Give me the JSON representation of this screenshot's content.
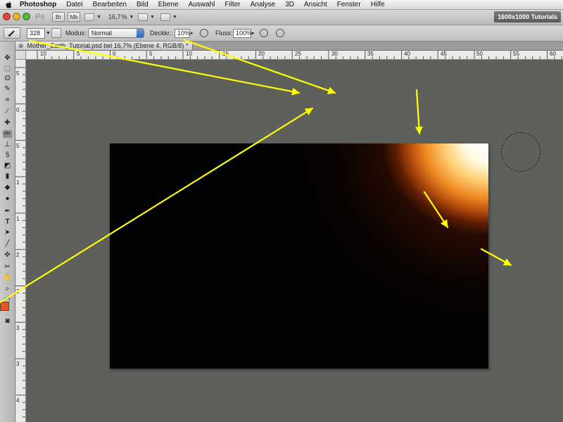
{
  "menubar": {
    "app_name": "Photoshop",
    "items": [
      "Datei",
      "Bearbeiten",
      "Bild",
      "Ebene",
      "Auswahl",
      "Filter",
      "Analyse",
      "3D",
      "Ansicht",
      "Fenster",
      "Hilfe"
    ]
  },
  "appbar": {
    "ps_logo": "Ps",
    "br_label": "Br",
    "mb_label": "Mb",
    "zoom": "16,7",
    "workspace": "1600x1000 Tutorials"
  },
  "options": {
    "brush_size": "328",
    "mode_label": "Modus:",
    "mode_value": "Normal",
    "opacity_label": "Deckkr.:",
    "opacity_value": "10%",
    "flow_label": "Fluss:",
    "flow_value": "100%"
  },
  "document": {
    "tab_title": "Mother_Earth_Tutorial.psd bei 16,7% (Ebene 4, RGB/8) *"
  },
  "rulers": {
    "horizontal": [
      "10",
      "5",
      "0",
      "5",
      "10",
      "15",
      "20",
      "25",
      "30",
      "35",
      "40",
      "45",
      "50",
      "55",
      "60"
    ],
    "vertical": [
      "5",
      "0",
      "5",
      "1",
      "1",
      "2",
      "2",
      "3",
      "3",
      "4"
    ]
  },
  "colors": {
    "foreground": "#e8531e",
    "background": "#ffffff",
    "annotation": "#ffff00",
    "canvas_bg": "#5d605b"
  },
  "icons": [
    "apple-icon",
    "brush-tool-icon",
    "move-icon",
    "marquee-icon",
    "lasso-icon",
    "quick-select-icon",
    "crop-icon",
    "eyedropper-icon",
    "healing-icon",
    "brush-icon",
    "stamp-icon",
    "history-brush-icon",
    "eraser-icon",
    "gradient-icon",
    "blur-icon",
    "dodge-icon",
    "pen-icon",
    "type-icon",
    "path-select-icon",
    "shape-icon",
    "3d-rotate-icon",
    "3d-camera-icon",
    "hand-icon",
    "zoom-icon",
    "quick-mask-icon"
  ]
}
